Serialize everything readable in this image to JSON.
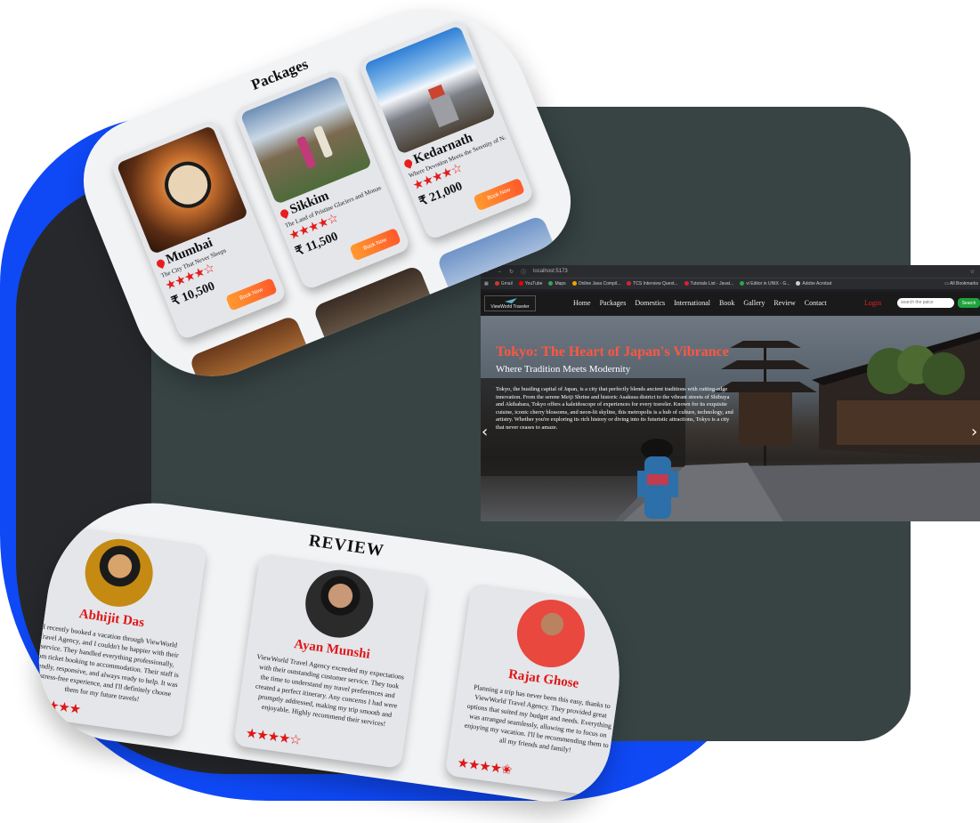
{
  "packages": {
    "title": "Packages",
    "cards": [
      {
        "name": "Mumbai",
        "tagline": "The City That Never Sleeps",
        "stars": "★★★★☆",
        "price": "₹ 10,500",
        "button": "Book Now"
      },
      {
        "name": "Sikkim",
        "tagline": "The Land of Pristine Glaciers and Monasteries",
        "stars": "★★★★☆",
        "price": "₹ 11,500",
        "button": "Book Now"
      },
      {
        "name": "Kedarnath",
        "tagline": "Where Devotion Meets the Serenity of Nature",
        "stars": "★★★★☆",
        "price": "₹ 21,000",
        "button": "Book Now"
      }
    ]
  },
  "browser": {
    "url": "localhost:5173",
    "bookmarks": [
      "Gmail",
      "YouTube",
      "Maps",
      "Online Java Compil...",
      "TCS Interview Quest...",
      "Tutorials List - Javat...",
      "vi Editor in UNIX - G...",
      "Adobe Acrobat"
    ],
    "all_bookmarks": "All Bookmarks",
    "site": {
      "logo": "ViewWorld Traveler",
      "nav": [
        "Home",
        "Packages",
        "Domestics",
        "International",
        "Book",
        "Gallery",
        "Review",
        "Contact"
      ],
      "login": "Login",
      "search_placeholder": "search the palce",
      "search_button": "Search"
    },
    "hero": {
      "title": "Tokyo: The Heart of Japan's Vibrance",
      "subtitle": "Where Tradition Meets Modernity",
      "description": "Tokyo, the bustling capital of Japan, is a city that perfectly blends ancient traditions with cutting-edge innovation. From the serene Meiji Shrine and historic Asakusa district to the vibrant streets of Shibuya and Akihabara, Tokyo offers a kaleidoscope of experiences for every traveler. Known for its exquisite cuisine, iconic cherry blossoms, and neon-lit skyline, this metropolis is a hub of culture, technology, and artistry. Whether you're exploring its rich history or diving into its futuristic attractions, Tokyo is a city that never ceases to amaze."
    }
  },
  "review": {
    "title": "REVIEW",
    "cards": [
      {
        "name": "Abhijit Das",
        "text": "I recently booked a vacation through ViewWorld Travel Agency, and I couldn't be happier with their service. They handled everything professionally, from ticket booking to accommodation. Their staff is friendly, responsive, and always ready to help. It was a stress-free experience, and I'll definitely choose them for my future travels!",
        "stars": "★★★★★"
      },
      {
        "name": "Ayan Munshi",
        "text": "ViewWorld Travel Agency exceeded my expectations with their outstanding customer service. They took the time to understand my travel preferences and created a perfect itinerary. Any concerns I had were promptly addressed, making my trip smooth and enjoyable. Highly recommend their services!",
        "stars": "★★★★☆"
      },
      {
        "name": "Rajat Ghose",
        "text": "Planning a trip has never been this easy, thanks to ViewWorld Travel Agency. They provided great options that suited my budget and needs. Everything was arranged seamlessly, allowing me to focus on enjoying my vacation. I'll be recommending them to all my friends and family!",
        "stars": "★★★★✬"
      }
    ]
  },
  "colors": {
    "accent_red": "#e01616",
    "brand_blue": "#0f48f5",
    "slate": "#384444",
    "orange": "#ff7a2c",
    "green": "#1ea33b"
  }
}
